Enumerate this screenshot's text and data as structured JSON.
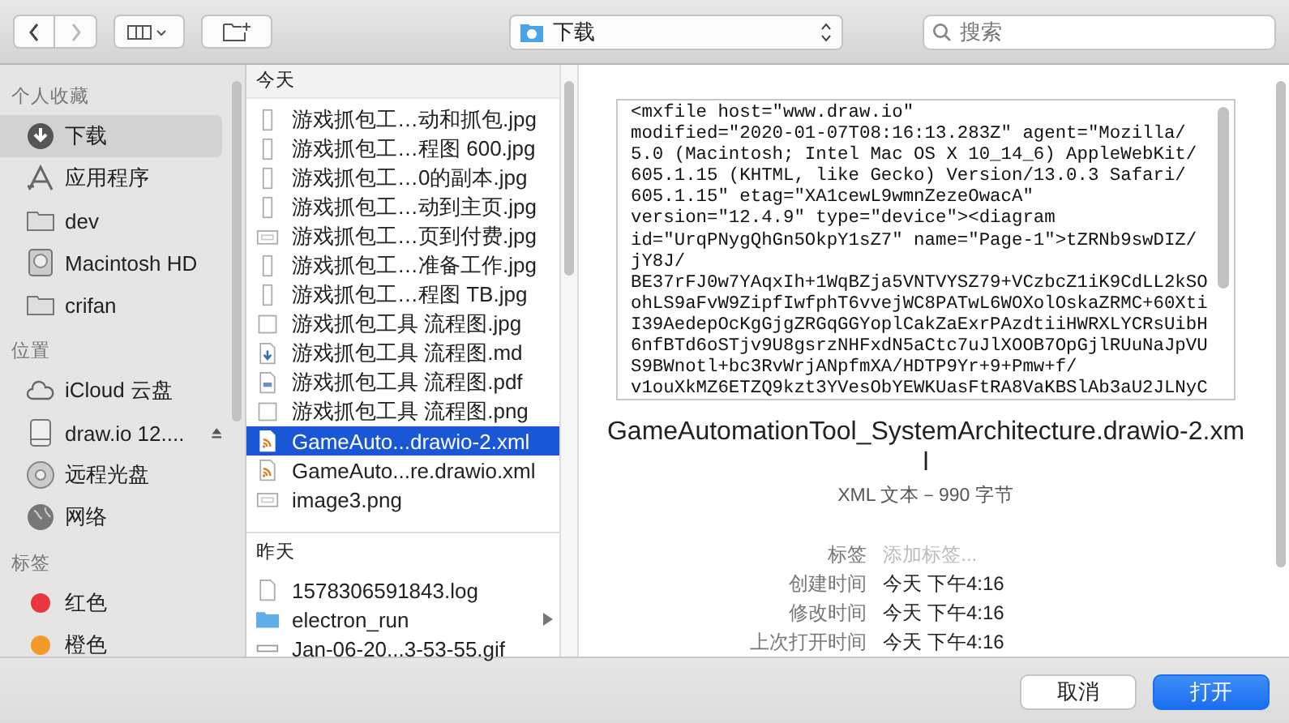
{
  "toolbar": {
    "location": "下载",
    "search": {
      "placeholder": "搜索"
    }
  },
  "sidebar": {
    "sections": [
      {
        "title": "个人收藏",
        "items": [
          {
            "label": "下载",
            "kind": "downloads",
            "selected": true
          },
          {
            "label": "应用程序",
            "kind": "apps",
            "selected": false
          },
          {
            "label": "dev",
            "kind": "folder",
            "selected": false
          },
          {
            "label": "Macintosh HD",
            "kind": "disk",
            "selected": false
          },
          {
            "label": "crifan",
            "kind": "folder",
            "selected": false
          }
        ]
      },
      {
        "title": "位置",
        "items": [
          {
            "label": "iCloud 云盘",
            "kind": "cloud",
            "selected": false
          },
          {
            "label": "draw.io 12....",
            "kind": "volume",
            "selected": false
          },
          {
            "label": "远程光盘",
            "kind": "optical",
            "selected": false
          },
          {
            "label": "网络",
            "kind": "network",
            "selected": false
          }
        ]
      },
      {
        "title": "标签",
        "items": [
          {
            "label": "红色",
            "kind": "tag",
            "color": "#e8383d",
            "selected": false
          },
          {
            "label": "橙色",
            "kind": "tag",
            "color": "#f39a2b",
            "selected": false
          }
        ]
      }
    ]
  },
  "files": {
    "groups": [
      {
        "title": "今天",
        "files": [
          {
            "name": "游戏抓包工…动和抓包.jpg",
            "kind": "image",
            "selected": false
          },
          {
            "name": "游戏抓包工…程图 600.jpg",
            "kind": "image",
            "selected": false
          },
          {
            "name": "游戏抓包工…0的副本.jpg",
            "kind": "image",
            "selected": false
          },
          {
            "name": "游戏抓包工…动到主页.jpg",
            "kind": "image",
            "selected": false
          },
          {
            "name": "游戏抓包工…页到付费.jpg",
            "kind": "wide-image",
            "selected": false
          },
          {
            "name": "游戏抓包工…准备工作.jpg",
            "kind": "image",
            "selected": false
          },
          {
            "name": "游戏抓包工…程图 TB.jpg",
            "kind": "image",
            "selected": false
          },
          {
            "name": "游戏抓包工具 流程图.jpg",
            "kind": "square-image",
            "selected": false
          },
          {
            "name": "游戏抓包工具 流程图.md",
            "kind": "markdown",
            "selected": false
          },
          {
            "name": "游戏抓包工具 流程图.pdf",
            "kind": "pdf",
            "selected": false
          },
          {
            "name": "游戏抓包工具 流程图.png",
            "kind": "square-image",
            "selected": false
          },
          {
            "name": "GameAuto...drawio-2.xml",
            "kind": "xml",
            "selected": true
          },
          {
            "name": "GameAuto...re.drawio.xml",
            "kind": "xml",
            "selected": false
          },
          {
            "name": "image3.png",
            "kind": "wide-image",
            "selected": false
          }
        ]
      },
      {
        "title": "昨天",
        "files": [
          {
            "name": "1578306591843.log",
            "kind": "document",
            "selected": false
          },
          {
            "name": "electron_run",
            "kind": "folder",
            "selected": false
          },
          {
            "name": "Jan-06-20...3-53-55.gif",
            "kind": "gif",
            "selected": false
          }
        ]
      }
    ]
  },
  "preview": {
    "content": [
      "<mxfile host=\"www.draw.io\"",
      "modified=\"2020-01-07T08:16:13.283Z\" agent=\"Mozilla/",
      "5.0 (Macintosh; Intel Mac OS X 10_14_6) AppleWebKit/",
      "605.1.15 (KHTML, like Gecko) Version/13.0.3 Safari/",
      "605.1.15\" etag=\"XA1cewL9wmnZezeOwacA\"",
      "version=\"12.4.9\" type=\"device\"><diagram",
      "id=\"UrqPNygQhGn5OkpY1sZ7\" name=\"Page-1\">tZRNb9swDIZ/",
      "jY8J/",
      "BE37rFJ0w7YAqxIh+1WqBZja5VNTVYSZ79+VCzbcZ1iK9CdLL2kSO",
      "ohLS9aFvW9ZipfIwfphT6vvejWC8PATwL6WOXolOskaZRMC+60Xti",
      "I39AedepOcKgGjgZRGqGGYoplCakZaExrPAzdtiiHWRXLYCRsUibH",
      "6nfBTd6oSTjv9U8gsrzNHFxdN5aCtc7uJlXOOB7OpGjlRUuNaJpVU",
      "S9BWnotl+bc3RvWrjANpfmXA/HDTP9Yr+9+Pmw+f/",
      "v1ouXkMZ6ETZQ9kzt3YVesObYEWKUasFtRA8VaKBSlAb3aU2JLNyC"
    ],
    "filename": "GameAutomationTool_SystemArchitecture.drawio-2.xml",
    "summary": "XML 文本－990 字节",
    "fields": [
      {
        "label": "标签",
        "placeholder": "添加标签..."
      },
      {
        "label": "创建时间",
        "value": "今天 下午4:16"
      },
      {
        "label": "修改时间",
        "value": "今天 下午4:16"
      },
      {
        "label": "上次打开时间",
        "value": "今天 下午4:16"
      }
    ]
  },
  "buttons": [
    {
      "label": "取消",
      "kind": "default"
    },
    {
      "label": "打开",
      "kind": "primary"
    }
  ]
}
